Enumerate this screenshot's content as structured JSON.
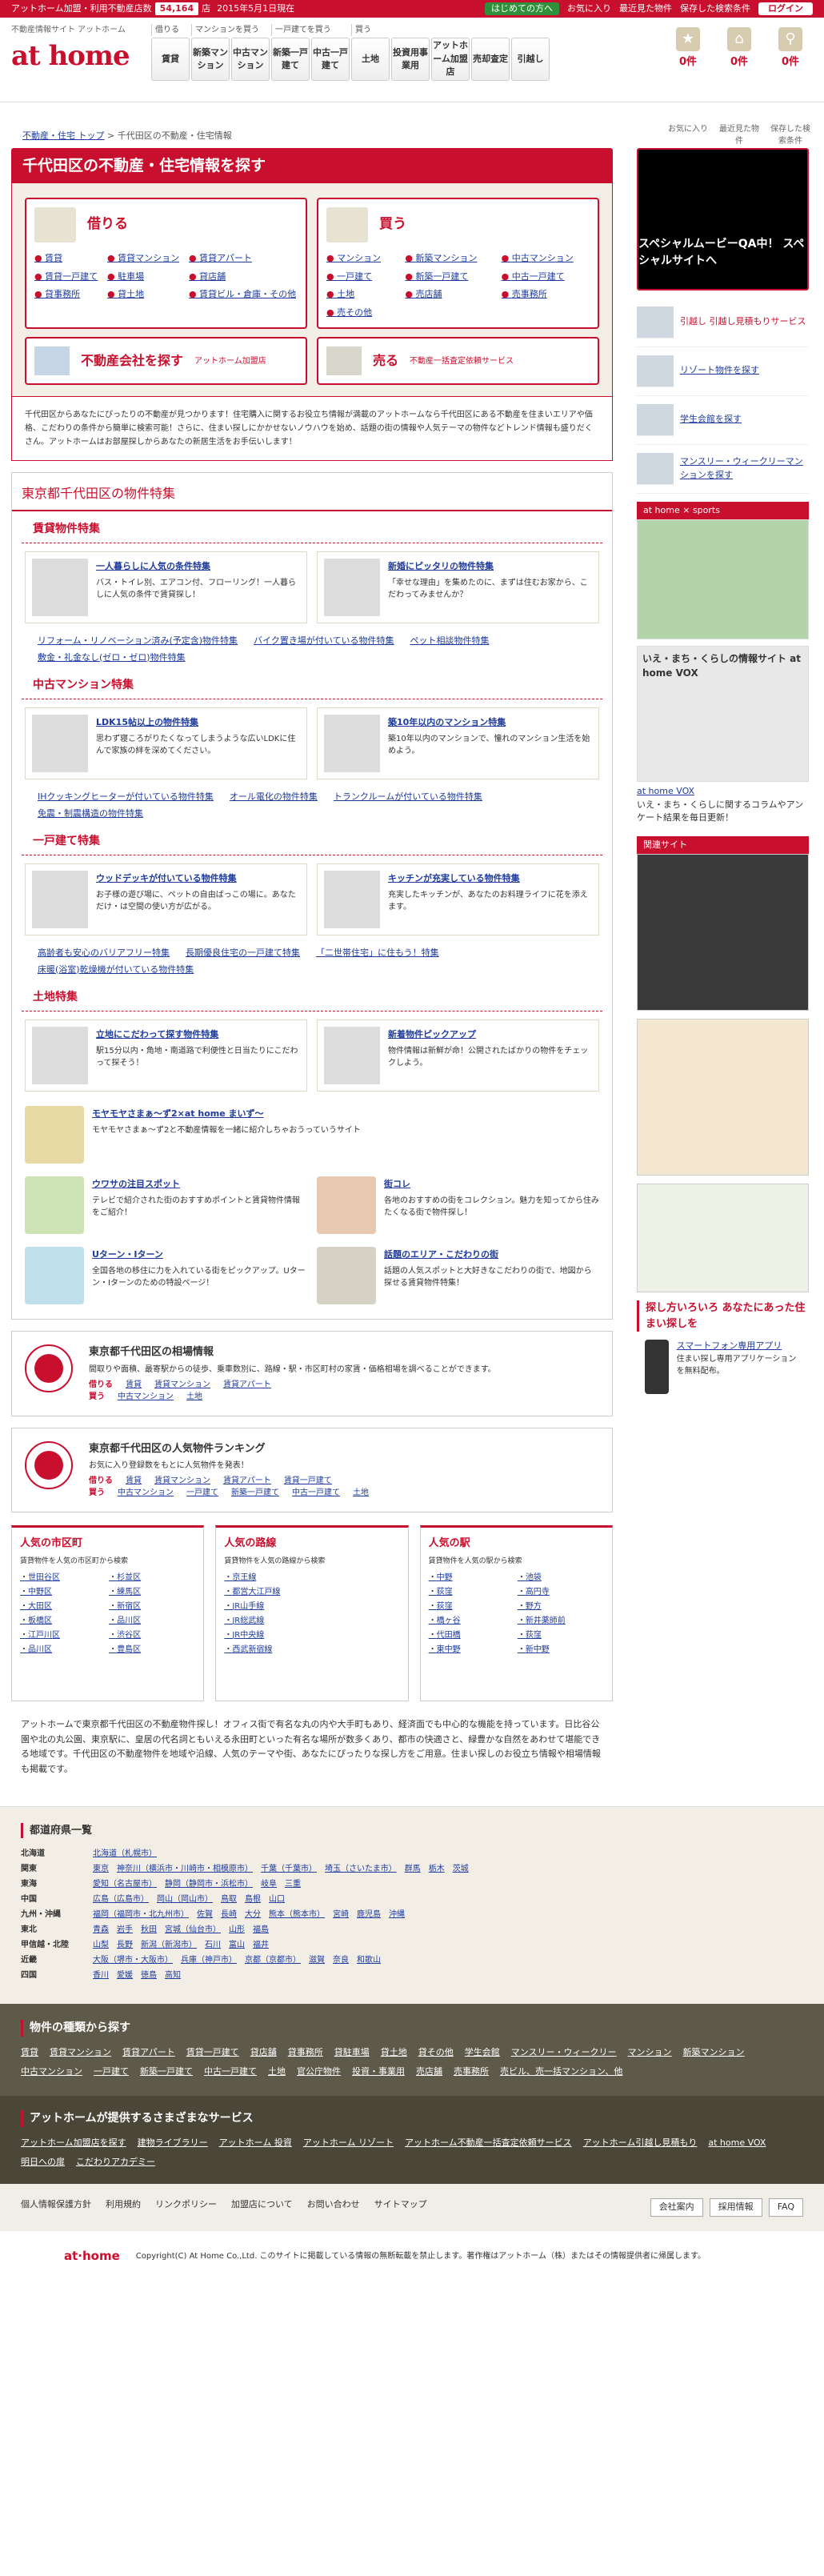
{
  "topbar": {
    "label": "アットホーム加盟・利用不動産店数",
    "count": "54,164",
    "unit": "店",
    "date": "2015年5月1日現在",
    "start": "はじめての方へ",
    "fav": "お気に入り",
    "recent": "最近見た物件",
    "saved": "保存した検索条件",
    "login": "ログイン"
  },
  "header": {
    "site": "不動産情報サイト アットホーム",
    "logo": "at home",
    "groups": [
      "借りる",
      "マンションを買う",
      "一戸建てを買う",
      "買う"
    ],
    "nav": [
      "賃貸",
      "新築マンション",
      "中古マンション",
      "新築一戸建て",
      "中古一戸建て",
      "土地",
      "投資用事業用",
      "アットホーム加盟店",
      "売却査定",
      "引越し"
    ],
    "icons": [
      {
        "n": "0件",
        "l": "お気に入り"
      },
      {
        "n": "0件",
        "l": "最近見た物件"
      },
      {
        "n": "0件",
        "l": "保存した検索条件"
      }
    ]
  },
  "breadcrumb": [
    "不動産・住宅 トップ",
    "千代田区の不動産・住宅情報"
  ],
  "main": {
    "title": "千代田区の不動産・住宅情報を探す",
    "rent": {
      "title": "借りる",
      "items": [
        "賃貸",
        "賃貸マンション",
        "賃貸アパート",
        "賃貸一戸建て",
        "駐車場",
        "貸店舗",
        "貸事務所",
        "貸土地",
        "賃貸ビル・倉庫・その他"
      ]
    },
    "buy": {
      "title": "買う",
      "items": [
        "マンション",
        "新築マンション",
        "中古マンション",
        "一戸建て",
        "新築一戸建て",
        "中古一戸建て",
        "土地",
        "売店舗",
        "売事務所",
        "売その他"
      ]
    },
    "agent": {
      "title": "不動産会社を探す",
      "sub": "アットホーム加盟店"
    },
    "sell": {
      "title": "売る",
      "sub": "不動産一括査定依頼サービス"
    },
    "intro": "千代田区からあなたにぴったりの不動産が見つかります！住宅購入に関するお役立ち情報が満載のアットホームなら千代田区にある不動産を住まいエリアや価格、こだわりの条件から簡単に検索可能！さらに、住まい探しにかかせないノウハウを始め、話題の街の情報や人気テーマの物件などトレンド情報も盛りだくさん。アットホームはお部屋探しからあなたの新居生活をお手伝いします！"
  },
  "special": {
    "title": "東京都千代田区の物件特集",
    "rent": {
      "title": "賃貸物件特集",
      "cards": [
        {
          "t": "一人暮らしに人気の条件特集",
          "d": "バス・トイレ別、エアコン付、フローリング！一人暮らしに人気の条件で賃貸探し！"
        },
        {
          "t": "新婚にピッタリの物件特集",
          "d": "「幸せな理由」を集めたのに、まずは住むお家から、こだわってみませんか？"
        }
      ],
      "tags": [
        "リフォーム・リノベーション済み(予定含)物件特集",
        "バイク置き場が付いている物件特集",
        "ペット相談物件特集",
        "敷金・礼金なし(ゼロ・ゼロ)物件特集"
      ]
    },
    "mansion": {
      "title": "中古マンション特集",
      "cards": [
        {
          "t": "LDK15帖以上の物件特集",
          "d": "思わず寝ころがりたくなってしまうような広いLDKに住んで家族の絆を深めてください。"
        },
        {
          "t": "築10年以内のマンション特集",
          "d": "築10年以内のマンションで、憧れのマンション生活を始めよう。"
        }
      ],
      "tags": [
        "IHクッキングヒーターが付いている物件特集",
        "オール電化の物件特集",
        "トランクルームが付いている物件特集",
        "免震・制震構造の物件特集"
      ]
    },
    "house": {
      "title": "一戸建て特集",
      "cards": [
        {
          "t": "ウッドデッキが付いている物件特集",
          "d": "お子様の遊び場に、ペットの自由ばっこの場に。あなただけ・は空間の使い方が広がる。"
        },
        {
          "t": "キッチンが充実している物件特集",
          "d": "充実したキッチンが、あなたのお料理ライフに花を添えます。"
        }
      ],
      "tags": [
        "高齢者も安心のバリアフリー特集",
        "長期優良住宅の一戸建て特集",
        "「二世帯住宅」に住もう！特集",
        "床暖(浴室)乾燥機が付いている物件特集"
      ]
    },
    "land": {
      "title": "土地特集",
      "cards": [
        {
          "t": "立地にこだわって探す物件特集",
          "d": "駅15分以内・角地・南道路で利便性と日当たりにこだわって探そう！"
        },
        {
          "t": "新着物件ピックアップ",
          "d": "物件情報は新鮮が命！公開されたばかりの物件をチェックしよう。"
        }
      ]
    },
    "features": [
      {
        "t": "モヤモヤさまぁ～ず2×at home まいず～",
        "d": "モヤモヤさまぁ～ず2と不動産情報を一緒に紹介しちゃおうっていうサイト"
      },
      {
        "t": "ウワサの注目スポット",
        "d": "テレビで紹介された街のおすすめポイントと賃貸物件情報をご紹介！"
      },
      {
        "t": "街コレ",
        "d": "各地のおすすめの街をコレクション。魅力を知ってから住みたくなる街で物件探し！"
      },
      {
        "t": "Uターン・Iターン",
        "d": "全国各地の移住に力を入れている街をピックアップ。Uターン・Iターンのための特設ページ！"
      },
      {
        "t": "話題のエリア・こだわりの街",
        "d": "話題の人気スポットと大好きなこだわりの街で、地図から探せる賃貸物件特集！"
      }
    ]
  },
  "market": {
    "title": "東京都千代田区の相場情報",
    "desc": "間取りや面積、最寄駅からの徒歩、乗車数別に、路線・駅・市区町村の家賃・価格相場を調べることができます。",
    "rent_label": "借りる",
    "rent": [
      "賃貸",
      "賃貸マンション",
      "賃貸アパート"
    ],
    "buy_label": "買う",
    "buy": [
      "中古マンション",
      "土地"
    ]
  },
  "ranking": {
    "title": "東京都千代田区の人気物件ランキング",
    "desc": "お気に入り登録数をもとに人気物件を発表！",
    "rent_label": "借りる",
    "rent": [
      "賃貸",
      "賃貸マンション",
      "賃貸アパート",
      "賃貸一戸建て"
    ],
    "buy_label": "買う",
    "buy": [
      "中古マンション",
      "一戸建て",
      "新築一戸建て",
      "中古一戸建て",
      "土地"
    ]
  },
  "popular": [
    {
      "t": "人気の市区町",
      "d": "賃貸物件を人気の市区町から検索",
      "items": [
        "世田谷区",
        "杉並区",
        "中野区",
        "練馬区",
        "大田区",
        "新宿区",
        "板橋区",
        "品川区",
        "江戸川区",
        "渋谷区",
        "品川区",
        "豊島区"
      ]
    },
    {
      "t": "人気の路線",
      "d": "賃貸物件を人気の路線から検索",
      "items": [
        "京王線",
        "都営大江戸線",
        "JR山手線",
        "JR総武線",
        "JR中央線",
        "西武新宿線"
      ]
    },
    {
      "t": "人気の駅",
      "d": "賃貸物件を人気の駅から検索",
      "items": [
        "中野",
        "池袋",
        "荻窪",
        "高円寺",
        "荻窪",
        "野方",
        "橋ヶ谷",
        "新井薬師前",
        "代田橋",
        "荻窪",
        "東中野",
        "新中野"
      ]
    }
  ],
  "desc": "アットホームで東京都千代田区の不動産物件探し！オフィス街で有名な丸の内や大手町もあり、経済面でも中心的な機能を持っています。日比谷公園や北の丸公園、東京駅に、皇居の代名詞ともいえる永田町といった有名な場所が数多くあり、都市の快適さと、緑豊かな自然をあわせて堪能できる地域です。千代田区の不動産物件を地域や沿線、人気のテーマや街、あなたにぴったりな探し方をご用意。住まい探しのお役立ち情報や相場情報も掲載です。",
  "pref": {
    "title": "都道府県一覧",
    "rows": [
      {
        "r": "北海道",
        "p": [
          "北海道（札幌市）"
        ]
      },
      {
        "r": "関東",
        "p": [
          "東京",
          "神奈川（横浜市・川崎市・相模原市）",
          "千葉（千葉市）",
          "埼玉（さいたま市）",
          "群馬",
          "栃木",
          "茨城"
        ]
      },
      {
        "r": "東海",
        "p": [
          "愛知（名古屋市）",
          "静岡（静岡市・浜松市）",
          "岐阜",
          "三重"
        ]
      },
      {
        "r": "中国",
        "p": [
          "広島（広島市）",
          "岡山（岡山市）",
          "鳥取",
          "島根",
          "山口"
        ]
      },
      {
        "r": "九州・沖縄",
        "p": [
          "福岡（福岡市・北九州市）",
          "佐賀",
          "長崎",
          "大分",
          "熊本（熊本市）",
          "宮崎",
          "鹿児島",
          "沖縄"
        ]
      },
      {
        "r": "東北",
        "p": [
          "青森",
          "岩手",
          "秋田",
          "宮城（仙台市）",
          "山形",
          "福島"
        ]
      },
      {
        "r": "甲信越・北陸",
        "p": [
          "山梨",
          "長野",
          "新潟（新潟市）",
          "石川",
          "富山",
          "福井"
        ]
      },
      {
        "r": "近畿",
        "p": [
          "大阪（堺市・大阪市）",
          "兵庫（神戸市）",
          "京都（京都市）",
          "滋賀",
          "奈良",
          "和歌山"
        ]
      },
      {
        "r": "四国",
        "p": [
          "香川",
          "愛媛",
          "徳島",
          "高知"
        ]
      }
    ]
  },
  "types": {
    "title": "物件の種類から探す",
    "items": [
      "賃貸",
      "賃貸マンション",
      "賃貸アパート",
      "賃貸一戸建て",
      "貸店舗",
      "貸事務所",
      "貸駐車場",
      "貸土地",
      "貸その他",
      "学生会館",
      "マンスリー・ウィークリー",
      "マンション",
      "新築マンション",
      "中古マンション",
      "一戸建て",
      "新築一戸建て",
      "中古一戸建て",
      "土地",
      "官公庁物件",
      "投資・事業用",
      "売店舗",
      "売事務所",
      "売ビル、売一括マンション、他"
    ]
  },
  "services": {
    "title": "アットホームが提供するさまざまなサービス",
    "items": [
      "アットホーム加盟店を探す",
      "建物ライブラリー",
      "アットホーム 投資",
      "アットホーム リゾート",
      "アットホーム不動産一括査定依頼サービス",
      "アットホーム引越し見積もり",
      "at home VOX",
      "明日への扉",
      "こだわりアカデミー"
    ]
  },
  "footer": {
    "links": [
      "個人情報保護方針",
      "利用規約",
      "リンクポリシー",
      "加盟店について",
      "お問い合わせ",
      "サイトマップ"
    ],
    "right": [
      "会社案内",
      "採用情報",
      "FAQ"
    ],
    "logo": "at·home",
    "copy": "Copyright(C) At Home Co.,Ltd. このサイトに掲載している情報の無断転載を禁止します。著作権はアットホーム（株）またはその情報提供者に帰属します。"
  },
  "side": {
    "movie": "スペシャルムービーQA中！ スペシャルサイトへ",
    "moving": "引越し 引越し見積もりサービス",
    "links": [
      "リゾート物件を探す",
      "学生会館を探す",
      "マンスリー・ウィークリーマンションを探す"
    ],
    "sports": "at home × sports",
    "vox_head": "いえ・まち・くらしの情報サイト at home VOX",
    "vox_link": "at home VOX",
    "vox_desc": "いえ・まち・くらしに関するコラムやアンケート結果を毎日更新！",
    "related": "関連サイト",
    "search_head": "探し方いろいろ あなたにあった住まい探しを",
    "smart": "スマートフォン専用アプリ",
    "smart_d": "住まい探し専用アプリケーションを無料配布。"
  }
}
